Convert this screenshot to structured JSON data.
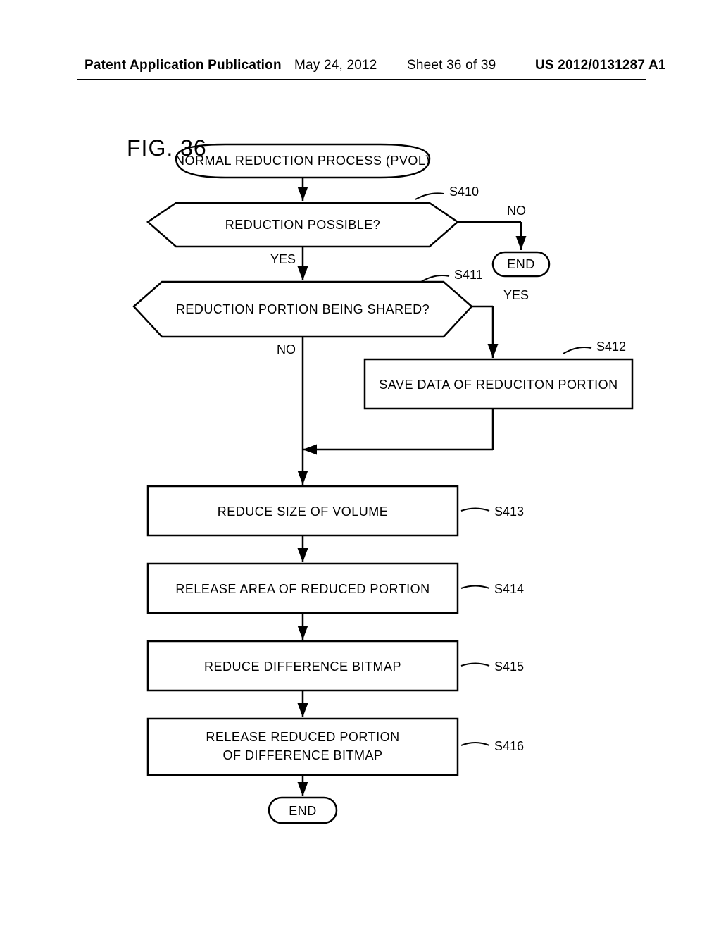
{
  "header": {
    "left": "Patent Application Publication",
    "date": "May 24, 2012",
    "sheet": "Sheet 36 of 39",
    "pub": "US 2012/0131287 A1"
  },
  "figure_title": "FIG. 36",
  "flow": {
    "start": "NORMAL REDUCTION PROCESS (PVOL)",
    "s410": {
      "text": "REDUCTION POSSIBLE?",
      "label": "S410",
      "yes": "YES",
      "no": "NO"
    },
    "s411": {
      "text": "REDUCTION PORTION BEING SHARED?",
      "label": "S411",
      "yes": "YES",
      "no": "NO"
    },
    "s412": {
      "text": "SAVE DATA OF REDUCITON PORTION",
      "label": "S412"
    },
    "s413": {
      "text": "REDUCE SIZE OF VOLUME",
      "label": "S413"
    },
    "s414": {
      "text": "RELEASE AREA OF REDUCED PORTION",
      "label": "S414"
    },
    "s415": {
      "text": "REDUCE DIFFERENCE BITMAP",
      "label": "S415"
    },
    "s416": {
      "line1": "RELEASE REDUCED PORTION",
      "line2": "OF DIFFERENCE BITMAP",
      "label": "S416"
    },
    "end": "END",
    "end_top": "END"
  }
}
